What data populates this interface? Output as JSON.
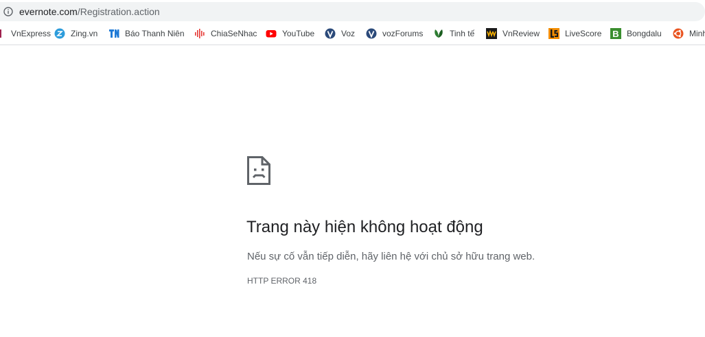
{
  "address_bar": {
    "host": "evernote.com",
    "path": "/Registration.action"
  },
  "bookmarks": [
    {
      "label": "VnExpress",
      "icon": "vnexpress-icon"
    },
    {
      "label": "Zing.vn",
      "icon": "zing-icon"
    },
    {
      "label": "Báo Thanh Niên",
      "icon": "thanhnien-icon"
    },
    {
      "label": "ChiaSeNhac",
      "icon": "chiasenhac-icon"
    },
    {
      "label": "YouTube",
      "icon": "youtube-icon"
    },
    {
      "label": "Voz",
      "icon": "voz-icon"
    },
    {
      "label": "vozForums",
      "icon": "vozforums-icon"
    },
    {
      "label": "Tinh tế",
      "icon": "tinhte-icon"
    },
    {
      "label": "VnReview",
      "icon": "vnreview-icon"
    },
    {
      "label": "LiveScore",
      "icon": "livescore-icon"
    },
    {
      "label": "Bongdalu",
      "icon": "bongdalu-icon"
    },
    {
      "label": "Minh",
      "icon": "ubuntu-icon"
    }
  ],
  "error": {
    "title": "Trang này hiện không hoạt động",
    "message": "Nếu sự cố vẫn tiếp diễn, hãy liên hệ với chủ sở hữu trang web.",
    "code": "HTTP ERROR 418"
  },
  "colors": {
    "youtube": "#ff0000",
    "zing": "#2d9cdb",
    "thanhnien": "#1f7ad6",
    "chiasenhac": "#e53935",
    "voz": "#2b4a7a",
    "tinhte": "#2e7d32",
    "livescore": "#f28c00",
    "bongdalu": "#3a8e2f",
    "ubuntu": "#e95420"
  }
}
